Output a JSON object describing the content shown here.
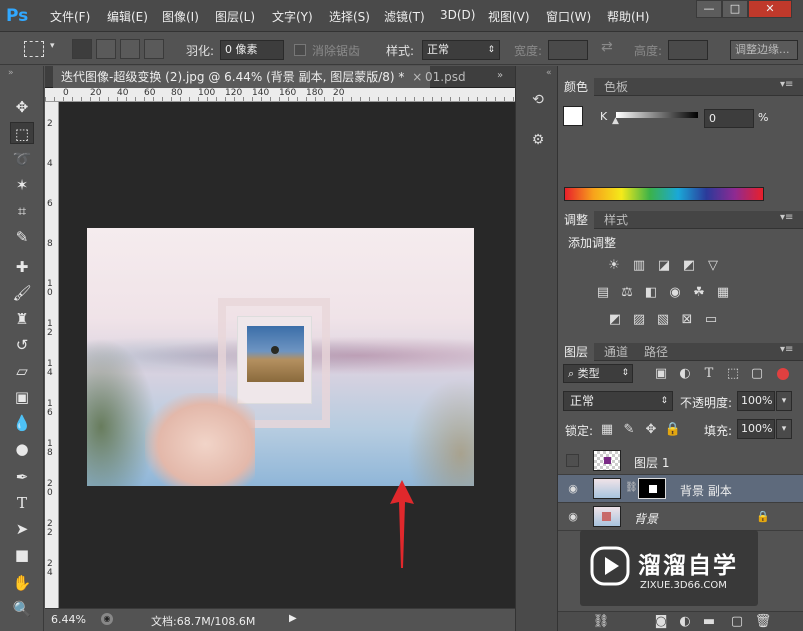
{
  "app": {
    "logo": "Ps"
  },
  "menu": [
    "文件(F)",
    "编辑(E)",
    "图像(I)",
    "图层(L)",
    "文字(Y)",
    "选择(S)",
    "滤镜(T)",
    "3D(D)",
    "视图(V)",
    "窗口(W)",
    "帮助(H)"
  ],
  "window_controls": {
    "minimize": "—",
    "maximize": "□",
    "close": "✕"
  },
  "options": {
    "feather_label": "羽化:",
    "feather_value": "0 像素",
    "antialias_label": "消除锯齿",
    "style_label": "样式:",
    "style_value": "正常",
    "width_label": "宽度:",
    "height_label": "高度:",
    "refine_edge": "调整边缘..."
  },
  "document": {
    "tab_active": "迭代图像-超级变换 (2).jpg @ 6.44% (背景 副本, 图层蒙版/8) *",
    "tab_close": "×",
    "tab_2": "01.psd",
    "ruler_h": [
      "0",
      "20",
      "40",
      "60",
      "80",
      "100",
      "120",
      "140",
      "160",
      "180",
      "20"
    ],
    "ruler_v": [
      "2",
      "4",
      "6",
      "8",
      "1 0",
      "1 2",
      "1 4",
      "1 6",
      "1 8",
      "2 0",
      "2 2",
      "2 4"
    ]
  },
  "status": {
    "zoom": "6.44%",
    "doc_size": "文档:68.7M/108.6M"
  },
  "color_panel": {
    "tabs": [
      "颜色",
      "色板"
    ],
    "channel_label": "K",
    "value": "0",
    "unit": "%",
    "colors": {
      "foreground": "#ffffff",
      "background": "#000000"
    }
  },
  "adjust_panel": {
    "tabs": [
      "调整",
      "样式"
    ],
    "heading": "添加调整"
  },
  "layers_panel": {
    "tabs": [
      "图层",
      "通道",
      "路径"
    ],
    "filter_label": "类型",
    "blend_mode": "正常",
    "opacity_label": "不透明度:",
    "opacity_value": "100%",
    "lock_label": "锁定:",
    "fill_label": "填充:",
    "fill_value": "100%",
    "layers": [
      {
        "name": "图层 1",
        "visible": false
      },
      {
        "name": "背景 副本",
        "visible": true,
        "selected": true
      },
      {
        "name": "背景",
        "visible": true,
        "locked": true
      }
    ]
  },
  "watermark": {
    "brand": "溜溜自学",
    "url": "ZIXUE.3D66.COM"
  }
}
